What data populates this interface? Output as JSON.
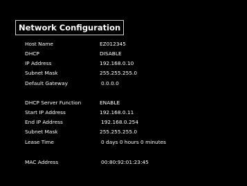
{
  "title": "Network Configuration",
  "network": [
    {
      "label": "Host Name",
      "value": "EZ012345"
    },
    {
      "label": "DHCP",
      "value": "DISABLE"
    },
    {
      "label": "IP Address",
      "value": "192.168.0.10"
    },
    {
      "label": "Subnet Mask",
      "value": "255.255.255.0"
    },
    {
      "label": "Default Gateway",
      "value": "0.0.0.0"
    }
  ],
  "dhcp_server": [
    {
      "label": "DHCP Server Function",
      "value": "ENABLE"
    },
    {
      "label": "Start IP Address",
      "value": "192.168.0.11"
    },
    {
      "label": "End IP Address",
      "value": "192.168.0.254"
    },
    {
      "label": "Subnet Mask",
      "value": "255.255.255.0"
    },
    {
      "label": "Lease Time",
      "value": "0 days 0 hours 0 minutes"
    }
  ],
  "mac": {
    "label": "MAC Address",
    "value": "00:80:92:01:23:45"
  }
}
